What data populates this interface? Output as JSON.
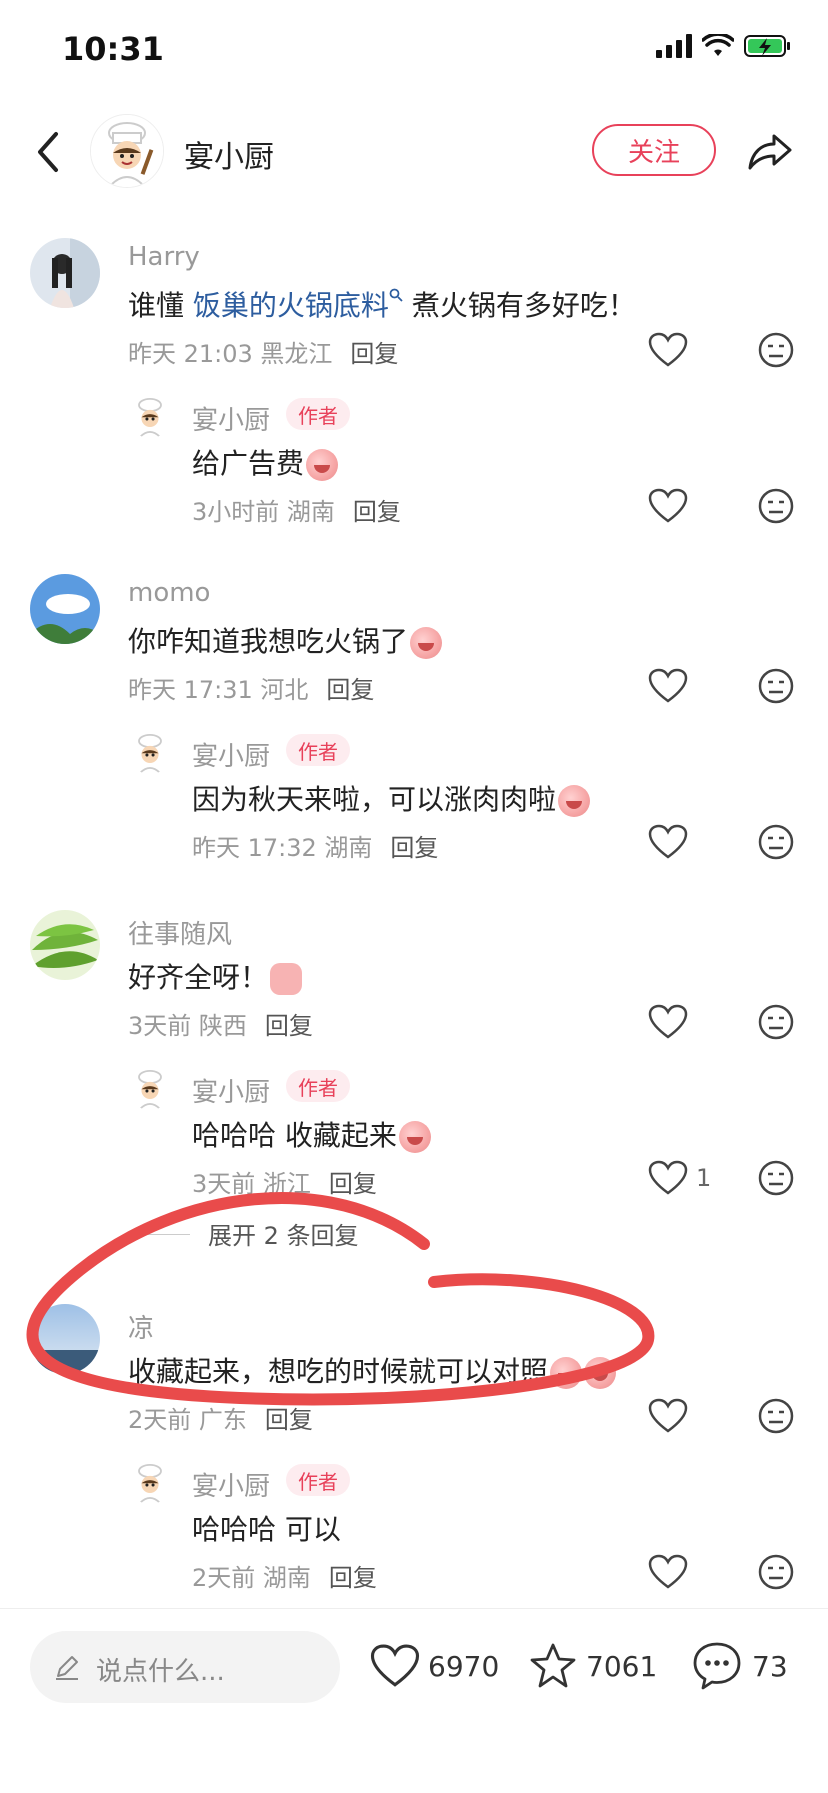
{
  "status_bar": {
    "time": "10:31"
  },
  "header": {
    "username": "宴小厨",
    "follow_label": "关注"
  },
  "comments": [
    {
      "username": "Harry",
      "text_prefix": "谁懂 ",
      "text_link": "饭巢的火锅底料",
      "text_suffix": " 煮火锅有多好吃！",
      "meta": "昨天 21:03 黑龙江",
      "reply_label": "回复",
      "reply": {
        "username": "宴小厨",
        "badge": "作者",
        "text": "给广告费",
        "meta": "3小时前 湖南",
        "reply_label": "回复"
      }
    },
    {
      "username": "momo",
      "text": "你咋知道我想吃火锅了",
      "meta": "昨天 17:31 河北",
      "reply_label": "回复",
      "reply": {
        "username": "宴小厨",
        "badge": "作者",
        "text": "因为秋天来啦，可以涨肉肉啦",
        "meta": "昨天 17:32 湖南",
        "reply_label": "回复"
      }
    },
    {
      "username": "往事随风",
      "text": "好齐全呀！",
      "meta": "3天前 陕西",
      "reply_label": "回复",
      "reply": {
        "username": "宴小厨",
        "badge": "作者",
        "text": "哈哈哈 收藏起来",
        "meta": "3天前 浙江",
        "reply_label": "回复",
        "like_count": "1"
      }
    },
    {
      "username": "凉",
      "text": "收藏起来，想吃的时候就可以对照",
      "meta": "2天前 广东",
      "reply_label": "回复",
      "reply": {
        "username": "宴小厨",
        "badge": "作者",
        "text": "哈哈哈 可以",
        "meta": "2天前 湖南",
        "reply_label": "回复"
      }
    }
  ],
  "expand_replies": "展开 2 条回复",
  "bottom_bar": {
    "input_placeholder": "说点什么...",
    "likes": "6970",
    "favorites": "7061",
    "comments": "73"
  },
  "colors": {
    "accent": "#e8415a",
    "link": "#2d5d9f",
    "annotation": "#e94b4b"
  }
}
